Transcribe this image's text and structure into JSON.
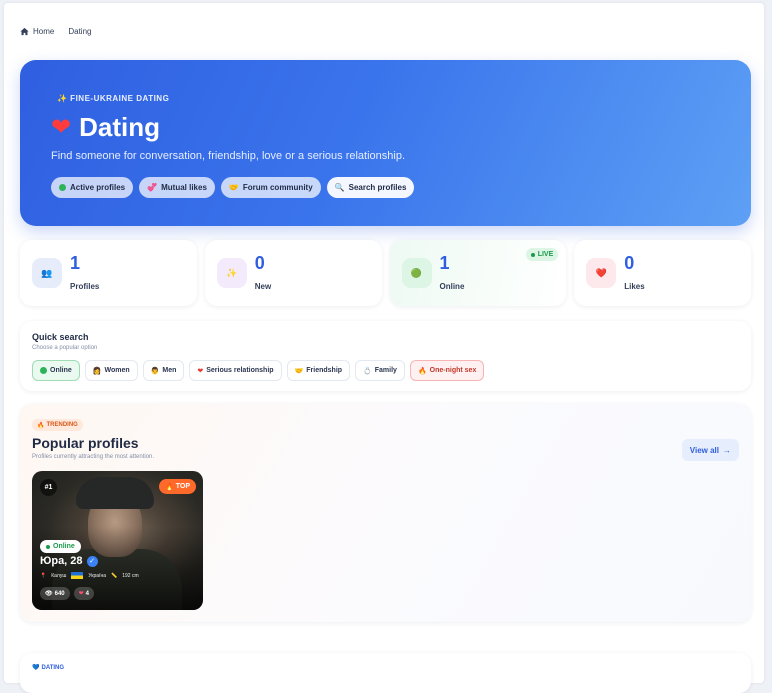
{
  "breadcrumb": {
    "home": "Home",
    "current": "Dating"
  },
  "hero": {
    "eyebrow": "✨ FINE-UKRAINE DATING",
    "title": "Dating",
    "subtitle": "Find someone for conversation, friendship, love or a serious relationship.",
    "pills": [
      "Active profiles",
      "Mutual likes",
      "Forum community",
      "Search profiles"
    ]
  },
  "stats": [
    {
      "icon": "👥",
      "value": "1",
      "label": "Profiles"
    },
    {
      "icon": "✨",
      "value": "0",
      "label": "New"
    },
    {
      "icon": "🟢",
      "value": "1",
      "label": "Online",
      "badge": "LIVE"
    },
    {
      "icon": "❤️",
      "value": "0",
      "label": "Likes"
    }
  ],
  "quick_search": {
    "title": "Quick search",
    "hint": "Choose a popular option",
    "chips": [
      "Online",
      "Women",
      "Men",
      "Serious relationship",
      "Friendship",
      "Family",
      "One-night sex"
    ]
  },
  "popular": {
    "badge": "TRENDING",
    "title": "Popular profiles",
    "description": "Profiles currently attracting the most attention.",
    "view_all": "View all",
    "profile": {
      "rank": "#1",
      "top_badge": "TOP",
      "status": "Online",
      "name": "Юра, 28",
      "city": "Калуш",
      "country": "Україна",
      "height": "192 cm",
      "views": "640",
      "likes": "4"
    }
  },
  "bottom": {
    "badge": "DATING"
  },
  "colors": {
    "accent": "#2f5fe0",
    "online": "#1c9b4b",
    "hot": "#ff6a2b"
  }
}
